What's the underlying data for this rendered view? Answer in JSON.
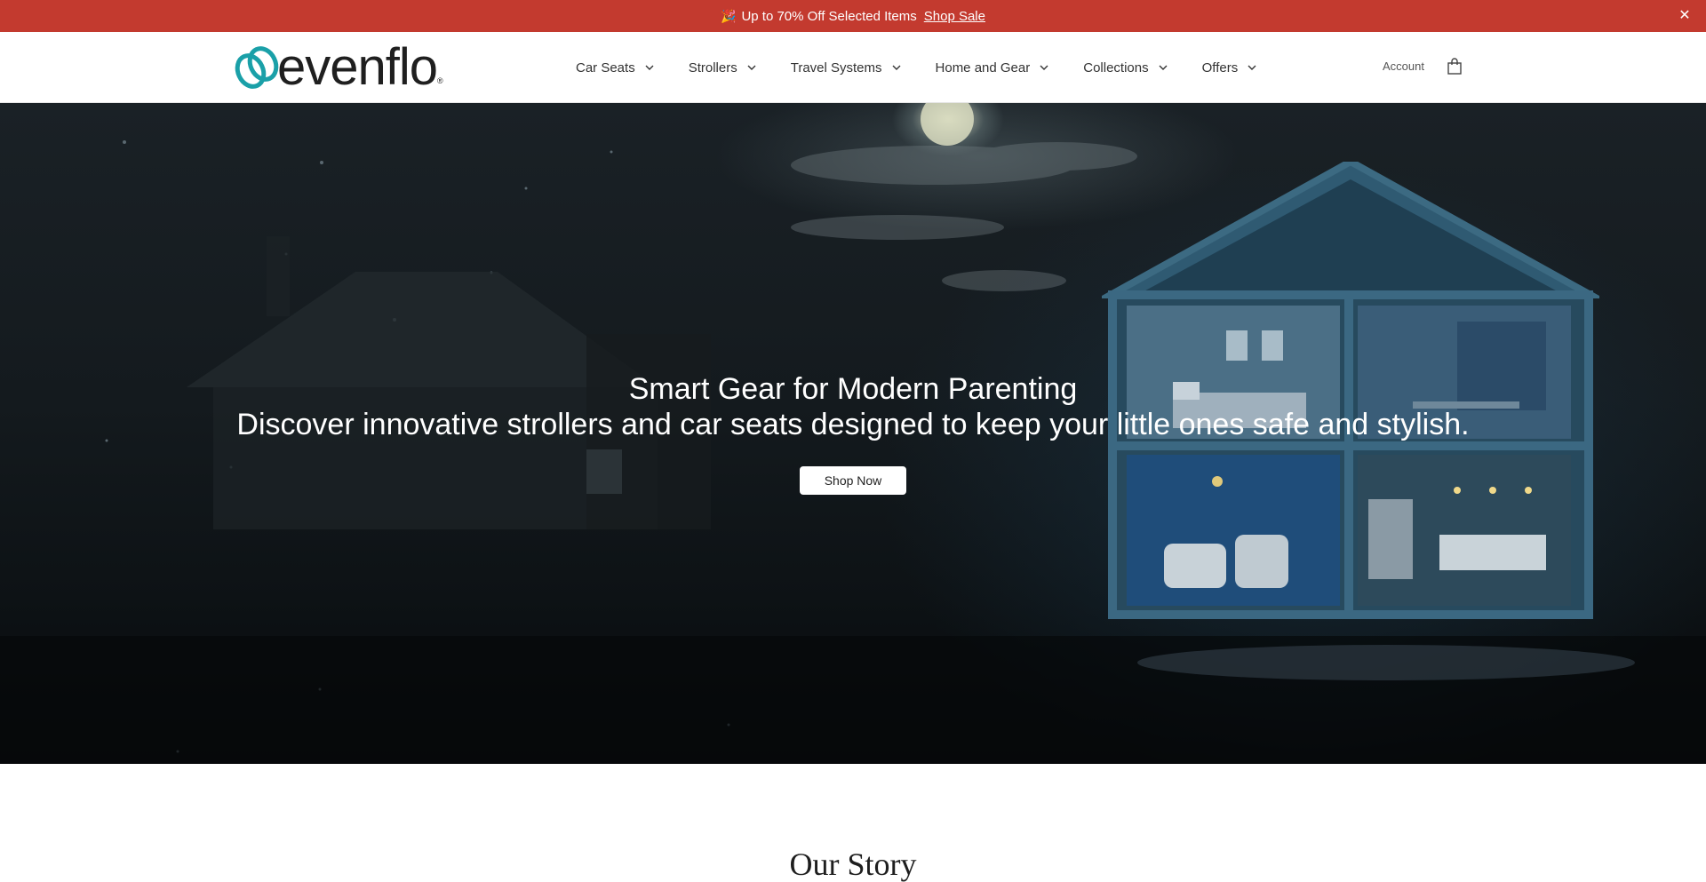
{
  "announcement": {
    "icon": "party-popper-icon",
    "emoji": "🎉",
    "message": "Up to 70% Off Selected Items",
    "link_label": "Shop Sale",
    "close_icon": "close-icon",
    "background": "#c33a2f"
  },
  "header": {
    "logo_text": "evenflo",
    "logo_mark": "®",
    "logo_color": "#1aa0a8",
    "nav": [
      {
        "label": "Car Seats"
      },
      {
        "label": "Strollers"
      },
      {
        "label": "Travel Systems"
      },
      {
        "label": "Home and Gear"
      },
      {
        "label": "Collections"
      },
      {
        "label": "Offers"
      }
    ],
    "account_label": "Account",
    "cart_icon": "shopping-bag-icon"
  },
  "hero": {
    "title": "Smart Gear for Modern Parenting",
    "subtitle": "Discover innovative strollers and car seats designed to keep your little ones safe and stylish.",
    "cta_label": "Shop Now"
  },
  "story": {
    "title": "Our Story"
  }
}
